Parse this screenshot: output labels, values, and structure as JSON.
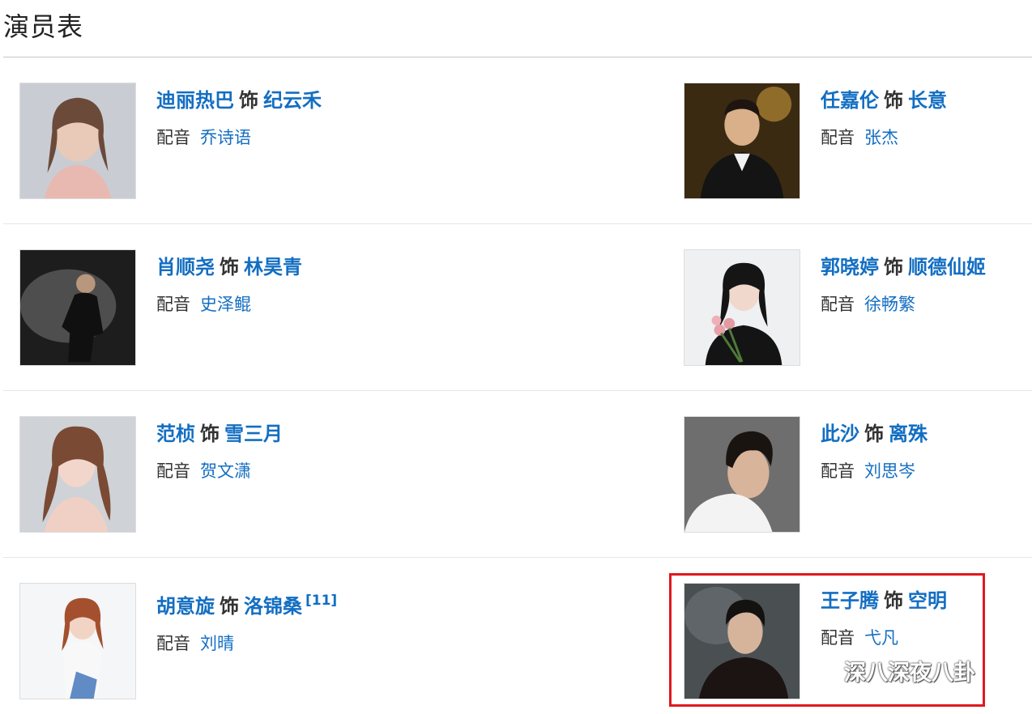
{
  "section": {
    "title": "演员表"
  },
  "labels": {
    "as_word": "饰",
    "voice_word": "配音"
  },
  "cast": [
    {
      "actor": "迪丽热巴",
      "role": "纪云禾",
      "voice": "乔诗语",
      "photo_icon": "actress-portrait-photo"
    },
    {
      "actor": "任嘉伦",
      "role": "长意",
      "voice": "张杰",
      "photo_icon": "actor-portrait-photo"
    },
    {
      "actor": "肖顺尧",
      "role": "林昊青",
      "voice": "史泽鲲",
      "photo_icon": "actor-portrait-photo"
    },
    {
      "actor": "郭晓婷",
      "role": "顺德仙姬",
      "voice": "徐畅繁",
      "photo_icon": "actress-portrait-photo"
    },
    {
      "actor": "范桢",
      "role": "雪三月",
      "voice": "贺文潇",
      "photo_icon": "actress-portrait-photo"
    },
    {
      "actor": "此沙",
      "role": "离殊",
      "voice": "刘思岑",
      "photo_icon": "actor-portrait-photo"
    },
    {
      "actor": "胡意旋",
      "role": "洛锦桑",
      "voice": "刘晴",
      "ref": "[11]",
      "photo_icon": "actress-portrait-photo"
    },
    {
      "actor": "王子腾",
      "role": "空明",
      "voice": "弋凡",
      "photo_icon": "actor-portrait-photo"
    }
  ],
  "watermark": {
    "text": "深八深夜八卦",
    "icon": "wechat-icon"
  },
  "colors": {
    "link": "#136ec2",
    "highlight": "#e0191e"
  }
}
